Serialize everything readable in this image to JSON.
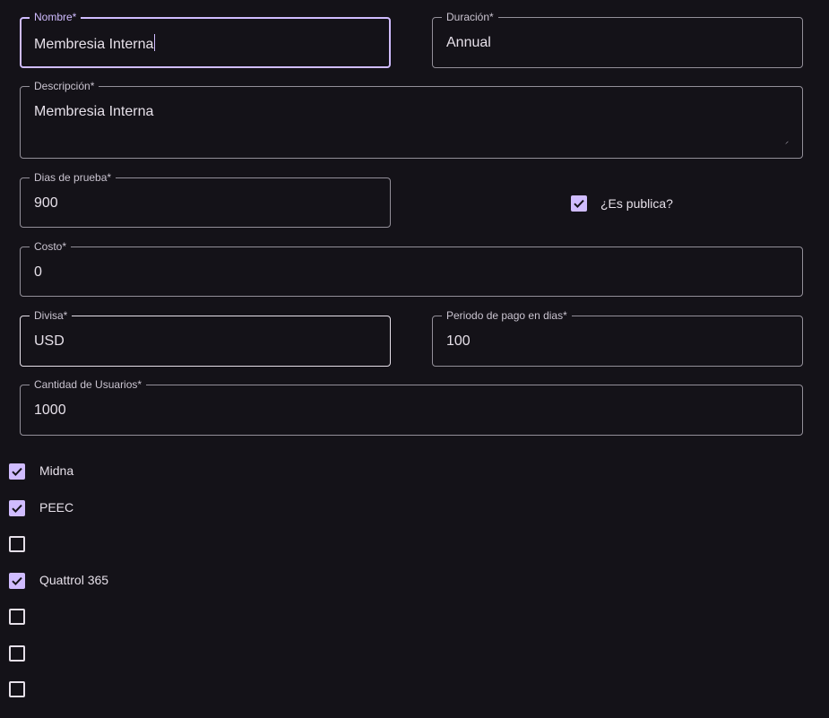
{
  "form": {
    "nombre": {
      "label": "Nombre*",
      "value": "Membresia Interna"
    },
    "duracion": {
      "label": "Duración*",
      "value": "Annual"
    },
    "descripcion": {
      "label": "Descripción*",
      "value": "Membresia Interna"
    },
    "dias_prueba": {
      "label": "Dias de prueba*",
      "value": "900"
    },
    "es_publica": {
      "label": "¿Es publica?",
      "checked": true
    },
    "costo": {
      "label": "Costo*",
      "value": "0"
    },
    "divisa": {
      "label": "Divisa*",
      "value": "USD"
    },
    "periodo_pago": {
      "label": "Periodo de pago en dias*",
      "value": "100"
    },
    "cantidad_usuarios": {
      "label": "Cantidad de Usuarios*",
      "value": "1000"
    }
  },
  "apps": [
    {
      "label": "Midna",
      "checked": true
    },
    {
      "label": "PEEC",
      "checked": true
    },
    {
      "label": "",
      "checked": false
    },
    {
      "label": "Quattrol 365",
      "checked": true
    },
    {
      "label": "",
      "checked": false
    },
    {
      "label": "",
      "checked": false
    },
    {
      "label": "",
      "checked": false
    }
  ],
  "colors": {
    "background": "#141218",
    "accent": "#d0bcff",
    "outline": "#938f99",
    "text": "#e6e0e9"
  }
}
